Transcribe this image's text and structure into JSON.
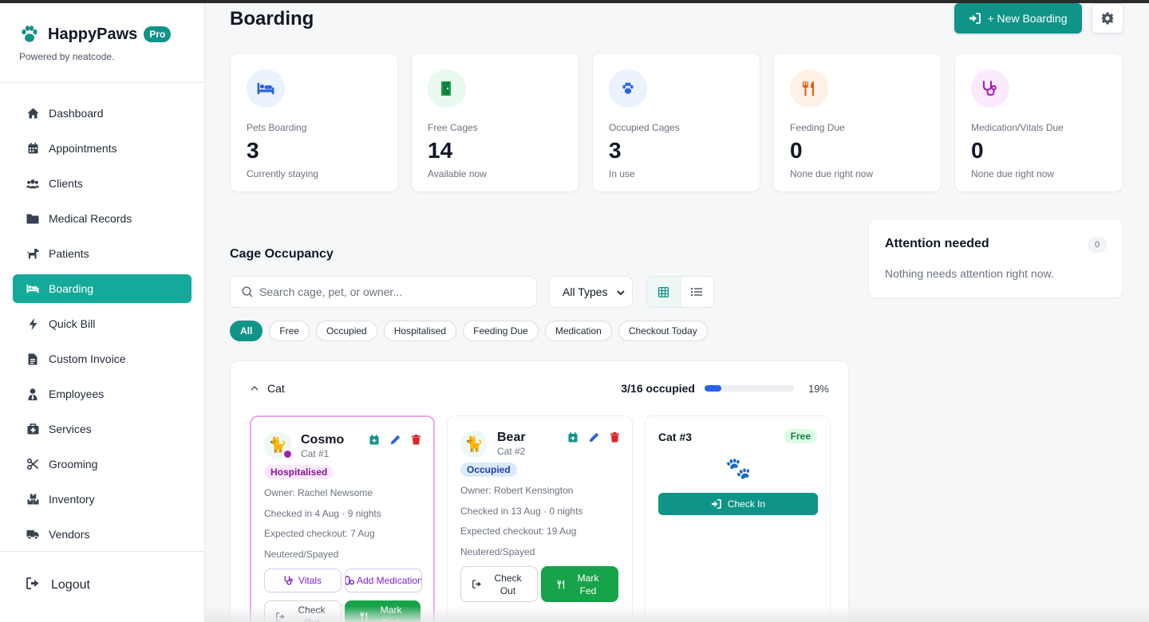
{
  "brand": {
    "name": "HappyPaws",
    "badge": "Pro",
    "powered_by": "Powered by neatcode."
  },
  "nav": [
    {
      "label": "Dashboard",
      "icon": "home-icon"
    },
    {
      "label": "Appointments",
      "icon": "calendar-icon"
    },
    {
      "label": "Clients",
      "icon": "users-icon"
    },
    {
      "label": "Medical Records",
      "icon": "folder-icon"
    },
    {
      "label": "Patients",
      "icon": "dog-icon"
    },
    {
      "label": "Boarding",
      "icon": "bed-icon",
      "active": true
    },
    {
      "label": "Quick Bill",
      "icon": "bolt-icon"
    },
    {
      "label": "Custom Invoice",
      "icon": "file-invoice-icon"
    },
    {
      "label": "Employees",
      "icon": "user-tie-icon"
    },
    {
      "label": "Services",
      "icon": "briefcase-medical-icon"
    },
    {
      "label": "Grooming",
      "icon": "scissors-icon"
    },
    {
      "label": "Inventory",
      "icon": "boxes-icon"
    },
    {
      "label": "Vendors",
      "icon": "truck-icon"
    }
  ],
  "logout": "Logout",
  "header": {
    "title": "Boarding",
    "new_button": "+ New Boarding"
  },
  "stats": [
    {
      "label": "Pets Boarding",
      "value": "3",
      "sub": "Currently staying",
      "icon": "bed-icon",
      "color": "#2563eb",
      "bg": "#eaf2fe"
    },
    {
      "label": "Free Cages",
      "value": "14",
      "sub": "Available now",
      "icon": "door-open-icon",
      "color": "#16a34a",
      "bg": "#e9f9ee"
    },
    {
      "label": "Occupied Cages",
      "value": "3",
      "sub": "In use",
      "icon": "paw-icon",
      "color": "#2563eb",
      "bg": "#eaf2fe"
    },
    {
      "label": "Feeding Due",
      "value": "0",
      "sub": "None due right now",
      "icon": "utensils-icon",
      "color": "#ea580c",
      "bg": "#fff1e6"
    },
    {
      "label": "Medication/Vitals Due",
      "value": "0",
      "sub": "None due right now",
      "icon": "stethoscope-icon",
      "color": "#a21caf",
      "bg": "#fbeafd"
    }
  ],
  "attention": {
    "title": "Attention needed",
    "count": "0",
    "message": "Nothing needs attention right now."
  },
  "occupancy": {
    "title": "Cage Occupancy",
    "search_placeholder": "Search cage, pet, or owner...",
    "type_select": "All Types",
    "filters": [
      "All",
      "Free",
      "Occupied",
      "Hospitalised",
      "Feeding Due",
      "Medication",
      "Checkout Today"
    ],
    "active_filter": "All",
    "group": {
      "name": "Cat",
      "occupied_text": "3/16 occupied",
      "percent_text": "19%",
      "fraction": 0.19
    }
  },
  "cards": [
    {
      "pet": "Cosmo",
      "cage": "Cat #1",
      "status": "Hospitalised",
      "owner": "Owner: Rachel Newsome",
      "checked_in": "Checked in 4 Aug · 9 nights",
      "checkout": "Expected checkout: 7 Aug",
      "neutered": "Neutered/Spayed",
      "vitals_label": "Vitals",
      "medication_label": "Add Medication",
      "checkout_label": "Check Out",
      "fed_label": "Mark Fed"
    },
    {
      "pet": "Bear",
      "cage": "Cat #2",
      "status": "Occupied",
      "owner": "Owner: Robert Kensington",
      "checked_in": "Checked in 13 Aug · 0 nights",
      "checkout": "Expected checkout: 19 Aug",
      "neutered": "Neutered/Spayed",
      "checkout_label": "Check Out",
      "fed_label": "Mark Fed"
    }
  ],
  "free_card": {
    "cage": "Cat #3",
    "badge": "Free",
    "checkin_label": "Check In"
  }
}
